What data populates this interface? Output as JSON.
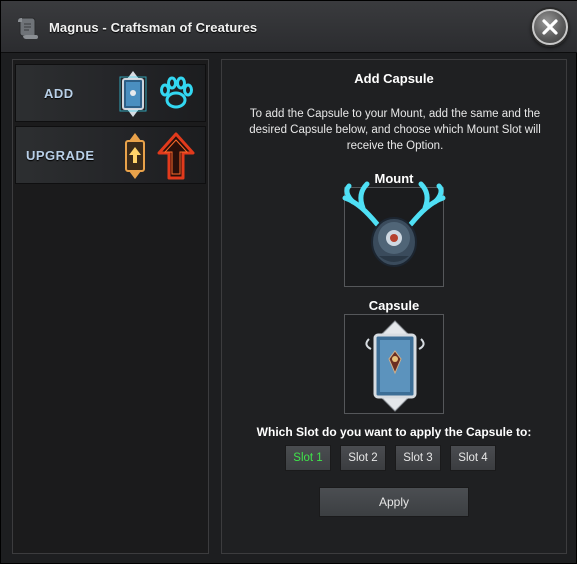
{
  "window": {
    "title": "Magnus - Craftsman of Creatures",
    "close_icon": "close-icon"
  },
  "sidebar": {
    "items": [
      {
        "label": "ADD",
        "icons": [
          "capsule-icon",
          "paw-icon"
        ]
      },
      {
        "label": "UPGRADE",
        "icons": [
          "upgrade-capsule-icon",
          "arrow-up-icon"
        ]
      }
    ]
  },
  "panel": {
    "title": "Add Capsule",
    "description": "To add the Capsule to your Mount, add the same and the desired Capsule below, and choose which Mount Slot will receive the Option.",
    "mount_heading": "Mount",
    "capsule_heading": "Capsule",
    "question": "Which Slot do you want to apply the Capsule to:",
    "slots": [
      {
        "label": "Slot 1",
        "selected": true
      },
      {
        "label": "Slot 2",
        "selected": false
      },
      {
        "label": "Slot 3",
        "selected": false
      },
      {
        "label": "Slot 4",
        "selected": false
      }
    ],
    "apply_label": "Apply"
  },
  "colors": {
    "selected_slot_text": "#3fe44a",
    "side_label": "#b9d0e8",
    "antler_cyan": "#4fe0f5",
    "arrow_red": "#e23a1c"
  }
}
